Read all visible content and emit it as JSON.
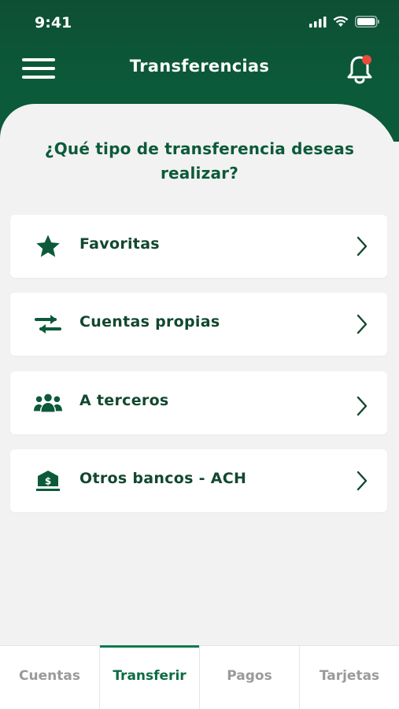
{
  "status_bar": {
    "time": "9:41"
  },
  "header": {
    "title": "Transferencias",
    "notification_badge_color": "#e84c3d"
  },
  "main": {
    "question": "¿Qué tipo de transferencia deseas realizar?",
    "options": [
      {
        "label": "Favoritas",
        "icon": "star-icon"
      },
      {
        "label": "Cuentas propias",
        "icon": "swap-arrows-icon"
      },
      {
        "label": "A terceros",
        "icon": "people-icon"
      },
      {
        "label": "Otros bancos - ACH",
        "icon": "bank-icon"
      }
    ]
  },
  "tabbar": {
    "tabs": [
      {
        "label": "Cuentas",
        "active": false
      },
      {
        "label": "Transferir",
        "active": true
      },
      {
        "label": "Pagos",
        "active": false
      },
      {
        "label": "Tarjetas",
        "active": false
      }
    ]
  },
  "colors": {
    "brand": "#0b5a3a",
    "accent": "#0c7a4f",
    "text": "#12482f"
  }
}
